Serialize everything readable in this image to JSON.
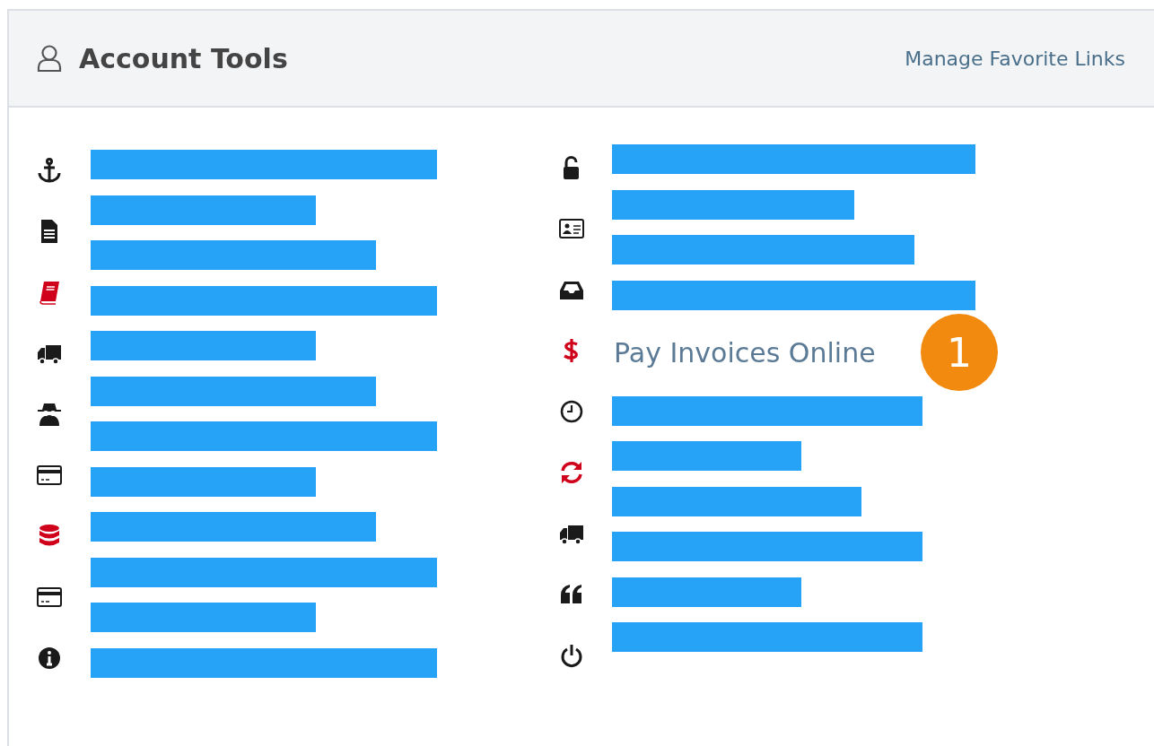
{
  "panel": {
    "title": "Account Tools",
    "header_link": "Manage Favorite Links"
  },
  "columns": [
    {
      "icons": [
        {
          "kind": "anchor",
          "color": "#1a1a1a"
        },
        {
          "kind": "document",
          "color": "#1a1a1a"
        },
        {
          "kind": "book",
          "color": "#d0021b"
        },
        {
          "kind": "truck",
          "color": "#1a1a1a"
        },
        {
          "kind": "spy",
          "color": "#1a1a1a"
        },
        {
          "kind": "card",
          "color": "#1a1a1a"
        },
        {
          "kind": "database",
          "color": "#d0021b"
        },
        {
          "kind": "card",
          "color": "#1a1a1a"
        },
        {
          "kind": "info",
          "color": "#1a1a1a"
        }
      ],
      "entries": [
        {
          "kind": "redacted"
        },
        {
          "kind": "redacted"
        },
        {
          "kind": "redacted"
        },
        {
          "kind": "redacted"
        },
        {
          "kind": "redacted"
        },
        {
          "kind": "redacted"
        },
        {
          "kind": "redacted"
        },
        {
          "kind": "redacted"
        },
        {
          "kind": "redacted"
        },
        {
          "kind": "redacted"
        },
        {
          "kind": "redacted"
        },
        {
          "kind": "redacted"
        }
      ]
    },
    {
      "icons": [
        {
          "kind": "unlock",
          "color": "#1a1a1a"
        },
        {
          "kind": "id-card",
          "color": "#1a1a1a"
        },
        {
          "kind": "inbox",
          "color": "#1a1a1a"
        },
        {
          "kind": "dollar",
          "color": "#d0021b"
        },
        {
          "kind": "clock",
          "color": "#1a1a1a"
        },
        {
          "kind": "refresh",
          "color": "#d0021b"
        },
        {
          "kind": "truck",
          "color": "#1a1a1a"
        },
        {
          "kind": "quote",
          "color": "#1a1a1a"
        },
        {
          "kind": "power",
          "color": "#1a1a1a"
        }
      ],
      "entries": [
        {
          "kind": "redacted"
        },
        {
          "kind": "redacted"
        },
        {
          "kind": "redacted"
        },
        {
          "kind": "redacted"
        },
        {
          "kind": "link",
          "text": "Pay Invoices Online",
          "badge": "1"
        },
        {
          "kind": "redacted"
        },
        {
          "kind": "redacted"
        },
        {
          "kind": "redacted"
        },
        {
          "kind": "redacted"
        },
        {
          "kind": "redacted"
        },
        {
          "kind": "redacted"
        }
      ]
    }
  ]
}
